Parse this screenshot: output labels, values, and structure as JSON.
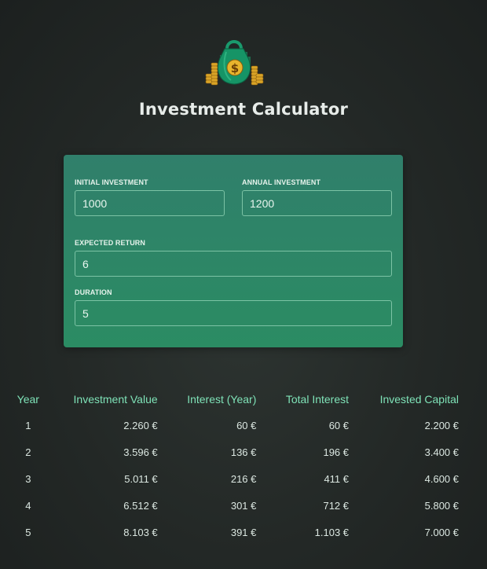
{
  "header": {
    "title": "Investment Calculator"
  },
  "inputs": {
    "initial_investment": {
      "label": "Initial Investment",
      "value": "1000"
    },
    "annual_investment": {
      "label": "Annual Investment",
      "value": "1200"
    },
    "expected_return": {
      "label": "Expected Return",
      "value": "6"
    },
    "duration": {
      "label": "Duration",
      "value": "5"
    }
  },
  "results": {
    "headers": [
      "Year",
      "Investment Value",
      "Interest (Year)",
      "Total Interest",
      "Invested Capital"
    ],
    "rows": [
      {
        "year": "1",
        "investment_value": "2.260 €",
        "interest_year": "60 €",
        "total_interest": "60 €",
        "invested_capital": "2.200 €"
      },
      {
        "year": "2",
        "investment_value": "3.596 €",
        "interest_year": "136 €",
        "total_interest": "196 €",
        "invested_capital": "3.400 €"
      },
      {
        "year": "3",
        "investment_value": "5.011 €",
        "interest_year": "216 €",
        "total_interest": "411 €",
        "invested_capital": "4.600 €"
      },
      {
        "year": "4",
        "investment_value": "6.512 €",
        "interest_year": "301 €",
        "total_interest": "712 €",
        "invested_capital": "5.800 €"
      },
      {
        "year": "5",
        "investment_value": "8.103 €",
        "interest_year": "391 €",
        "total_interest": "1.103 €",
        "invested_capital": "7.000 €"
      }
    ]
  },
  "colors": {
    "accent": "#7fe3b8",
    "panel": "#2b8c63",
    "background": "#232826"
  },
  "icons": {
    "logo": "money-bag-icon"
  }
}
